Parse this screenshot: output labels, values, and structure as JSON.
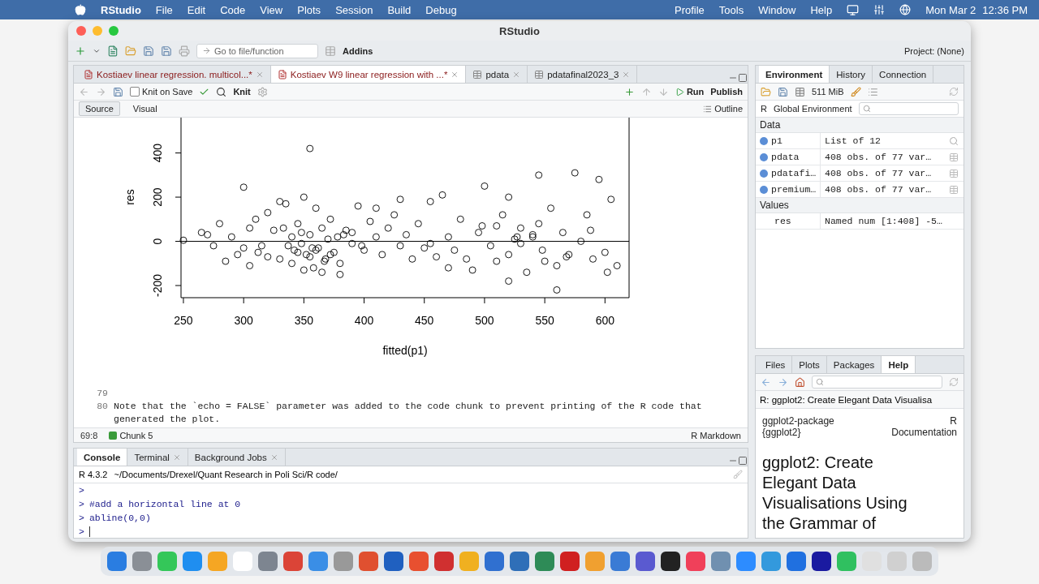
{
  "menubar": {
    "app": "RStudio",
    "menus": [
      "File",
      "Edit",
      "Code",
      "View",
      "Plots",
      "Session",
      "Build",
      "Debug"
    ],
    "right_menus": [
      "Profile",
      "Tools",
      "Window",
      "Help"
    ],
    "date": "Mon Mar 2",
    "time": "12:36 PM"
  },
  "window": {
    "title": "RStudio"
  },
  "toolbar": {
    "goto_placeholder": "Go to file/function",
    "addins": "Addins",
    "project": "Project: (None)"
  },
  "source": {
    "tabs": [
      {
        "label": "Kostiaev linear regression. multicol...*",
        "kind": "doc",
        "selected": false
      },
      {
        "label": "Kostiaev W9 linear regression with ...*",
        "kind": "doc",
        "selected": true
      },
      {
        "label": "pdata",
        "kind": "table",
        "selected": false
      },
      {
        "label": "pdatafinal2023_3",
        "kind": "table",
        "selected": false
      }
    ],
    "knit_on_save": {
      "label": "Knit on Save",
      "checked": false
    },
    "knit": "Knit",
    "run": "Run",
    "publish": "Publish",
    "modes": [
      {
        "label": "Source",
        "selected": true
      },
      {
        "label": "Visual",
        "selected": false
      }
    ],
    "outline": "Outline",
    "chart_data": {
      "type": "scatter",
      "xlabel": "fitted(p1)",
      "ylabel": "res",
      "xlim": [
        248,
        620
      ],
      "ylim": [
        -255,
        560
      ],
      "xticks": [
        250,
        300,
        350,
        400,
        450,
        500,
        550,
        600
      ],
      "yticks": [
        -200,
        0,
        200,
        400
      ],
      "x": [
        355,
        300,
        250,
        265,
        270,
        280,
        290,
        295,
        300,
        305,
        310,
        315,
        320,
        325,
        330,
        335,
        340,
        342,
        345,
        348,
        350,
        352,
        355,
        358,
        360,
        362,
        365,
        368,
        370,
        372,
        375,
        378,
        380,
        385,
        390,
        395,
        400,
        405,
        410,
        415,
        420,
        425,
        430,
        435,
        440,
        445,
        450,
        455,
        460,
        465,
        470,
        475,
        480,
        485,
        490,
        495,
        500,
        505,
        510,
        515,
        520,
        525,
        530,
        535,
        540,
        545,
        550,
        555,
        560,
        565,
        570,
        575,
        580,
        585,
        590,
        595,
        600,
        602,
        605,
        610,
        560,
        545,
        520,
        430,
        410,
        380,
        330,
        285,
        305,
        320,
        350,
        365,
        340,
        355,
        372,
        390,
        345,
        360,
        337,
        348,
        470,
        510,
        530,
        540,
        520,
        275,
        312,
        333,
        357,
        367,
        383,
        398,
        455,
        498,
        527,
        548,
        568,
        588
      ],
      "series": [
        {
          "color": "#000000",
          "values": [
            420,
            245,
            5,
            40,
            30,
            80,
            20,
            -60,
            -30,
            60,
            100,
            -20,
            130,
            50,
            -80,
            170,
            20,
            -40,
            80,
            -10,
            200,
            -60,
            30,
            -120,
            150,
            -30,
            60,
            -80,
            10,
            100,
            -50,
            20,
            -100,
            50,
            -10,
            160,
            -40,
            90,
            20,
            -60,
            60,
            120,
            -20,
            30,
            -80,
            80,
            -30,
            180,
            -70,
            210,
            20,
            -40,
            100,
            -80,
            -130,
            40,
            250,
            -20,
            70,
            120,
            -60,
            10,
            60,
            -140,
            20,
            80,
            -90,
            150,
            -110,
            40,
            -60,
            310,
            0,
            120,
            -80,
            280,
            -50,
            -140,
            190,
            -110,
            -220,
            300,
            -180,
            190,
            150,
            -150,
            180,
            -90,
            -110,
            -70,
            -130,
            -140,
            -100,
            -70,
            -60,
            40,
            -50,
            -40,
            -20,
            40,
            -120,
            -90,
            -10,
            30,
            200,
            -20,
            -50,
            60,
            -30,
            -90,
            30,
            -20,
            -10,
            70,
            20,
            -40,
            -70,
            50
          ]
        }
      ],
      "orientation": "vertical"
    },
    "lines": [
      {
        "number": "79"
      },
      {
        "number": "80",
        "text": "Note that the `echo = FALSE` parameter was added to the code chunk to prevent printing of the R code that generated the plot."
      }
    ],
    "status": {
      "position": "69:8",
      "chunk": "Chunk 5",
      "mode": "R Markdown"
    }
  },
  "console": {
    "tabs": [
      {
        "label": "Console",
        "selected": true,
        "closable": false
      },
      {
        "label": "Terminal",
        "selected": false,
        "closable": true
      },
      {
        "label": "Background Jobs",
        "selected": false,
        "closable": true
      }
    ],
    "version": "R 4.3.2",
    "path": "~/Documents/Drexel/Quant Research in Poli Sci/R code/",
    "lines": [
      {
        "prompt": ">"
      },
      {
        "prompt": ">",
        "text": "#add a horizontal line at 0"
      },
      {
        "prompt": ">",
        "text": "abline(0,0)"
      },
      {
        "prompt": ">"
      }
    ]
  },
  "environment": {
    "tabs": [
      {
        "label": "Environment",
        "selected": true
      },
      {
        "label": "History",
        "selected": false
      },
      {
        "label": "Connection",
        "selected": false
      }
    ],
    "memory": "511 MiB",
    "language": "R",
    "scope": "Global Environment",
    "sections": [
      {
        "title": "Data",
        "items": [
          {
            "name": "p1",
            "value": "List of  12",
            "kind": "list"
          },
          {
            "name": "pdata",
            "value": "408 obs. of 77 var…",
            "kind": "table"
          },
          {
            "name": "pdatafi…",
            "value": "408 obs. of 77 var…",
            "kind": "table"
          },
          {
            "name": "premium…",
            "value": "408 obs. of 77 var…",
            "kind": "table"
          }
        ]
      },
      {
        "title": "Values",
        "items": [
          {
            "name": "res",
            "value": "Named num [1:408] -5…",
            "kind": "value"
          }
        ]
      }
    ]
  },
  "help": {
    "tabs": [
      {
        "label": "Files",
        "selected": false
      },
      {
        "label": "Plots",
        "selected": false
      },
      {
        "label": "Packages",
        "selected": false
      },
      {
        "label": "Help",
        "selected": true
      }
    ],
    "topic": "R: ggplot2: Create Elegant Data Visualisa",
    "page_name": "ggplot2-package {ggplot2}",
    "doc_label": "R Documentation",
    "heading": "ggplot2: Create Elegant Data Visualisations Using the Grammar of"
  }
}
